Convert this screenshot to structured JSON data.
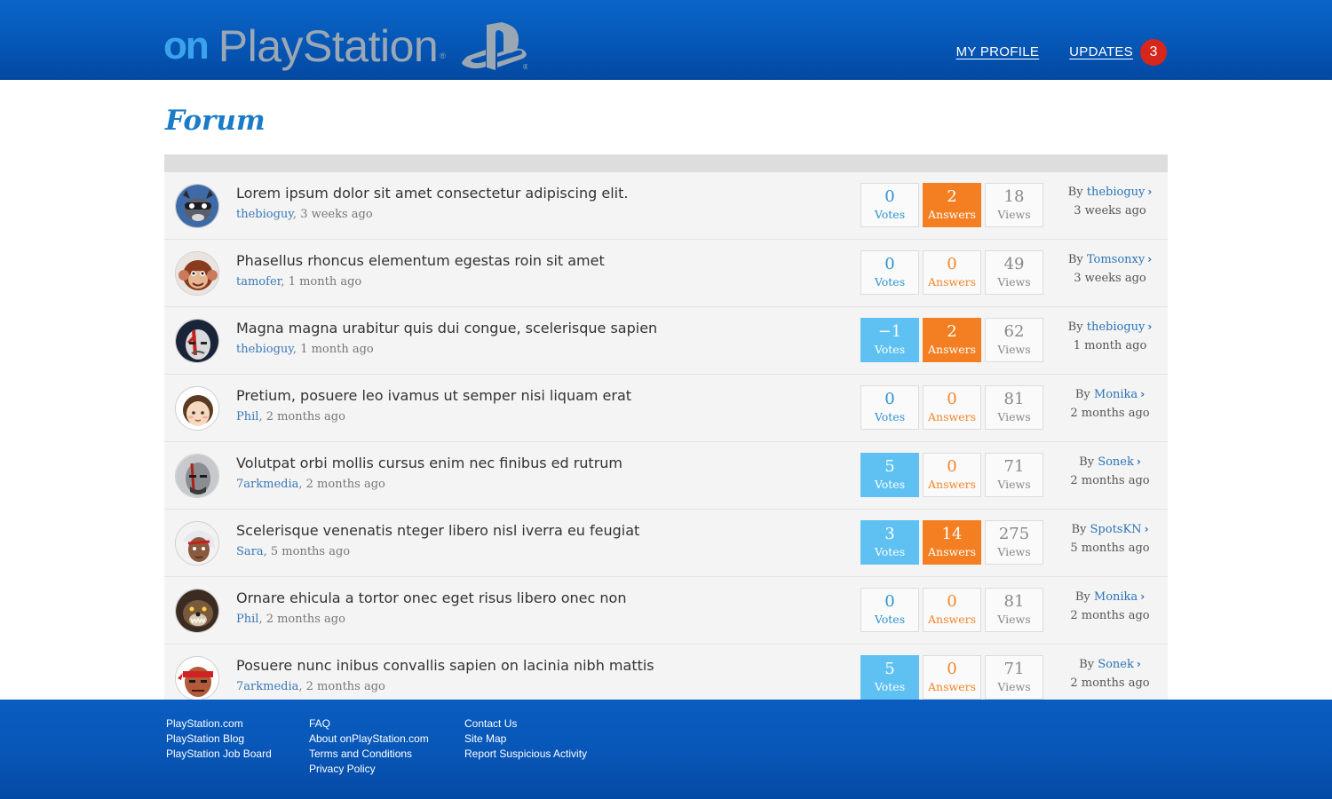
{
  "header": {
    "logo_on": "on",
    "logo_text": "PlayStation",
    "logo_reg": "®",
    "nav": {
      "profile_label": "MY PROFILE",
      "updates_label": "UPDATES",
      "updates_count": "3"
    }
  },
  "page": {
    "title": "Forum"
  },
  "labels": {
    "votes": "Votes",
    "answers": "Answers",
    "views": "Views",
    "by": "By"
  },
  "topics": [
    {
      "title": "Lorem ipsum dolor sit amet consectetur adipiscing elit.",
      "author": "thebioguy",
      "time": "3 weeks ago",
      "votes": "0",
      "answers": "2",
      "views": "18",
      "last_by": "thebioguy",
      "last_time": "3 weeks ago",
      "votes_hl": false,
      "answers_hl": true,
      "avatar": "raccoon-avatar"
    },
    {
      "title": "Phasellus rhoncus elementum egestas roin sit amet",
      "author": "tamofer",
      "time": "1 month ago",
      "votes": "0",
      "answers": "0",
      "views": "49",
      "last_by": "Tomsonxy",
      "last_time": "3 weeks ago",
      "votes_hl": false,
      "answers_hl": false,
      "avatar": "monkey-avatar"
    },
    {
      "title": "Magna magna urabitur quis dui congue, scelerisque sapien",
      "author": "thebioguy",
      "time": "1 month ago",
      "votes": "−1",
      "answers": "2",
      "views": "62",
      "last_by": "thebioguy",
      "last_time": "1 month ago",
      "votes_hl": true,
      "answers_hl": true,
      "avatar": "warrior-avatar"
    },
    {
      "title": "Pretium, posuere leo ivamus ut semper nisi liquam erat",
      "author": "Phil",
      "time": "2 months ago",
      "votes": "0",
      "answers": "0",
      "views": "81",
      "last_by": "Monika",
      "last_time": "2 months ago",
      "votes_hl": false,
      "answers_hl": false,
      "avatar": "girl-avatar"
    },
    {
      "title": "Volutpat orbi mollis cursus enim nec finibus ed rutrum",
      "author": "7arkmedia",
      "time": "2 months ago",
      "votes": "5",
      "answers": "0",
      "views": "71",
      "last_by": "Sonek",
      "last_time": "2 months ago",
      "votes_hl": true,
      "answers_hl": false,
      "avatar": "spartan-avatar"
    },
    {
      "title": "Scelerisque venenatis nteger libero nisl iverra eu feugiat",
      "author": "Sara",
      "time": "5 months ago",
      "votes": "3",
      "answers": "14",
      "views": "275",
      "last_by": "SpotsKN",
      "last_time": "5 months ago",
      "votes_hl": true,
      "answers_hl": true,
      "avatar": "fighter-avatar"
    },
    {
      "title": "Ornare ehicula a tortor onec eget risus libero onec non",
      "author": "Phil",
      "time": "2 months ago",
      "votes": "0",
      "answers": "0",
      "views": "81",
      "last_by": "Monika",
      "last_time": "2 months ago",
      "votes_hl": false,
      "answers_hl": false,
      "avatar": "beast-avatar"
    },
    {
      "title": "Posuere nunc inibus convallis sapien on lacinia nibh mattis",
      "author": "7arkmedia",
      "time": "2 months ago",
      "votes": "5",
      "answers": "0",
      "views": "71",
      "last_by": "Sonek",
      "last_time": "2 months ago",
      "votes_hl": true,
      "answers_hl": false,
      "avatar": "headband-avatar"
    }
  ],
  "footer": {
    "col1": [
      "PlayStation.com",
      "PlayStation Blog",
      "PlayStation Job Board"
    ],
    "col2": [
      "FAQ",
      "About onPlayStation.com",
      "Terms and Conditions",
      "Privacy Policy"
    ],
    "col3": [
      "Contact Us",
      "Site Map",
      "Report Suspicious Activity"
    ]
  }
}
